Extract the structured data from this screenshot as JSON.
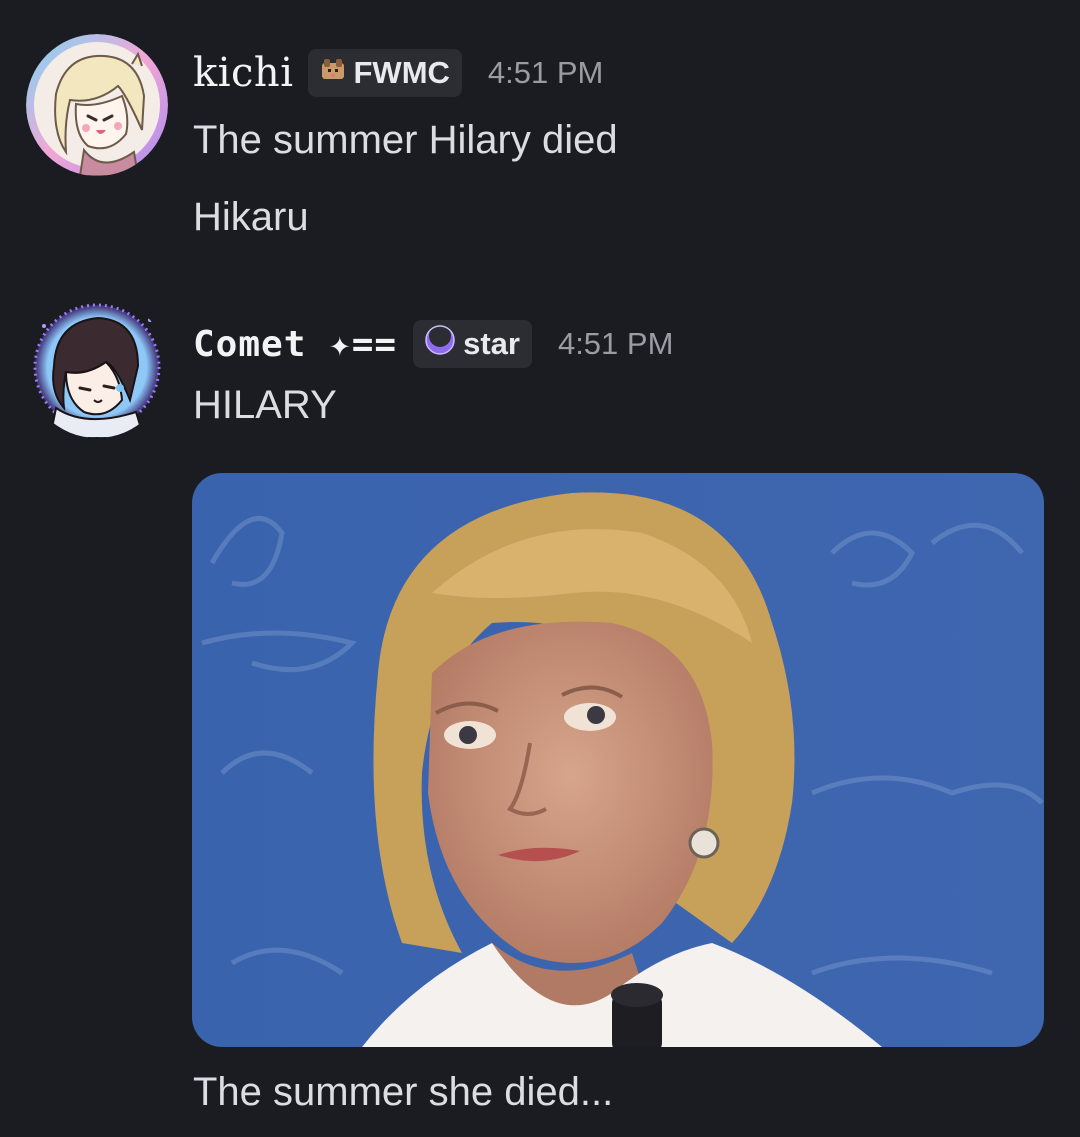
{
  "messages": [
    {
      "author": "kichi",
      "tag_label": "FWMC",
      "tag_icon": "dog-emoji-icon",
      "time": "4:51 PM",
      "lines": [
        "The summer Hilary died",
        "Hikaru"
      ]
    },
    {
      "author": "Comet ✦==",
      "tag_label": "star",
      "tag_icon": "crescent-moon-icon",
      "time": "4:51 PM",
      "lines": [
        "HILARY"
      ],
      "attachment_type": "image",
      "after_attachment": "The summer she died..."
    }
  ],
  "colors": {
    "background": "#1b1c21",
    "username": "#f2f3f5",
    "timestamp": "#9a9ca3",
    "tag_bg": "#2b2d33",
    "message_text": "#dbdee1",
    "moon_purple": "#8e6cf0"
  }
}
